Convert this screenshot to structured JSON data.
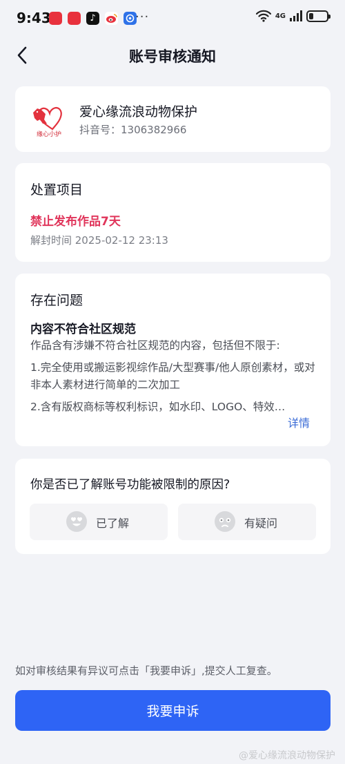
{
  "status_bar": {
    "time": "9:43",
    "dots": "···",
    "network": "4G"
  },
  "header": {
    "title": "账号审核通知"
  },
  "account": {
    "name": "爱心缘流浪动物保护",
    "id": "抖音号：1306382966",
    "logo_text": "缘心小护"
  },
  "penalty": {
    "section_title": "处置项目",
    "action": "禁止发布作品7天",
    "unban_time": "解封时间 2025-02-12 23:13"
  },
  "issue": {
    "section_title": "存在问题",
    "rule": "内容不符合社区规范",
    "desc": "作品含有涉嫌不符合社区规范的内容，包括但不限于:",
    "items": [
      "1.完全使用或搬运影视综作品/大型赛事/他人原创素材，或对非本人素材进行简单的二次加工",
      "2.含有版权商标等权利标识，如水印、LOGO、特效…"
    ],
    "more_label": "详情"
  },
  "feedback": {
    "question": "你是否已了解账号功能被限制的原因?",
    "option_yes": "已了解",
    "option_no": "有疑问"
  },
  "appeal": {
    "hint": "如对审核结果有异议可点击「我要申诉」,提交人工复查。",
    "button_label": "我要申诉"
  },
  "watermark": "@爱心缘流浪动物保护",
  "colors": {
    "accent": "#2e64f5",
    "penalty": "#e0345a",
    "background": "#f2f3f7"
  }
}
